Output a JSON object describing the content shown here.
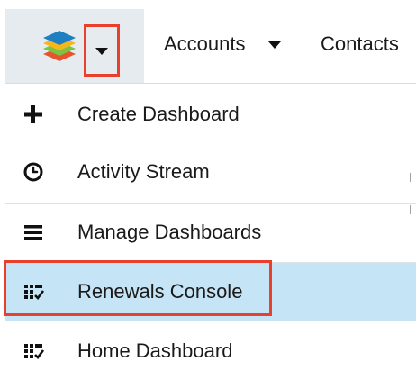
{
  "header": {
    "logo_icon": "sugar-layers-icon",
    "home_menu_toggle_icon": "caret-down-icon",
    "nav": [
      {
        "label": "Accounts",
        "icon": "caret-down-icon"
      },
      {
        "label": "Contacts"
      }
    ]
  },
  "menu": {
    "items": [
      {
        "label": "Create Dashboard",
        "icon": "plus-icon"
      },
      {
        "label": "Activity Stream",
        "icon": "clock-icon"
      },
      {
        "label": "Manage Dashboards",
        "icon": "list-icon"
      },
      {
        "label": "Renewals Console",
        "icon": "dashboard-check-icon",
        "active": true
      },
      {
        "label": "Home Dashboard",
        "icon": "dashboard-check-icon"
      }
    ]
  },
  "colors": {
    "highlight_border": "#e8402c",
    "active_row": "#c5e4f5",
    "home_tab_bg": "#e6ebf0"
  }
}
